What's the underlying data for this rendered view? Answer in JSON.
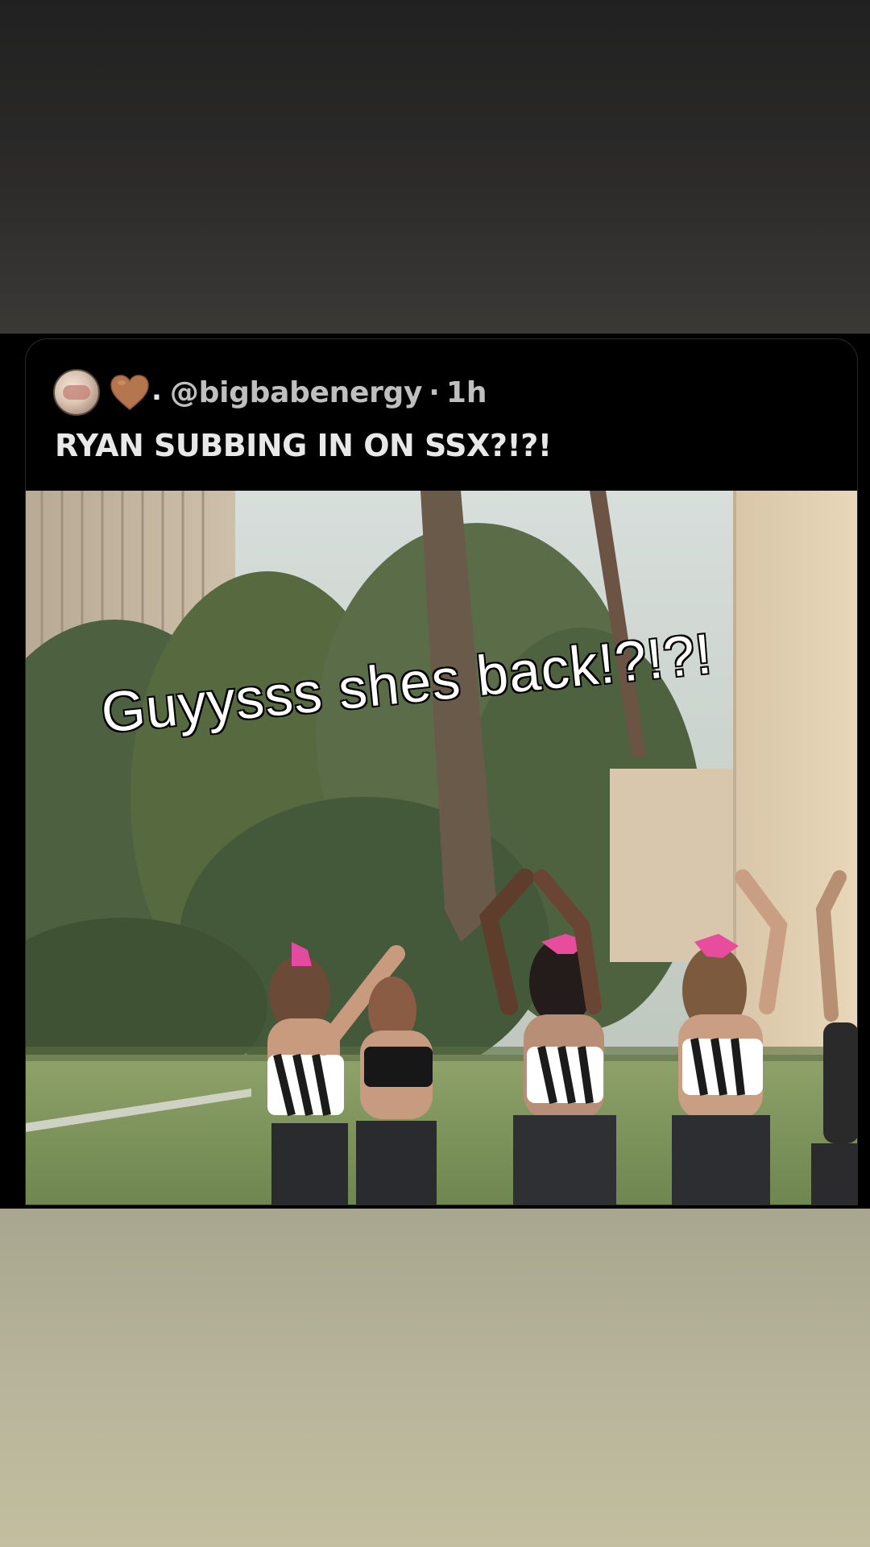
{
  "post": {
    "display_name_suffix": ".",
    "handle": "@bigbabenergy",
    "separator": "·",
    "time": "1h",
    "text": "RYAN SUBBING IN ON SSX?!?!"
  },
  "media": {
    "overlay_caption": "Guyysss shes back!?!?!"
  },
  "icons": {
    "avatar": "avatar-image",
    "heart": "brown-heart-emoji"
  },
  "colors": {
    "card_background": "#000000",
    "top_background": "#2a2a28",
    "bottom_background": "#b8b59b",
    "heart": "#b5764f"
  }
}
